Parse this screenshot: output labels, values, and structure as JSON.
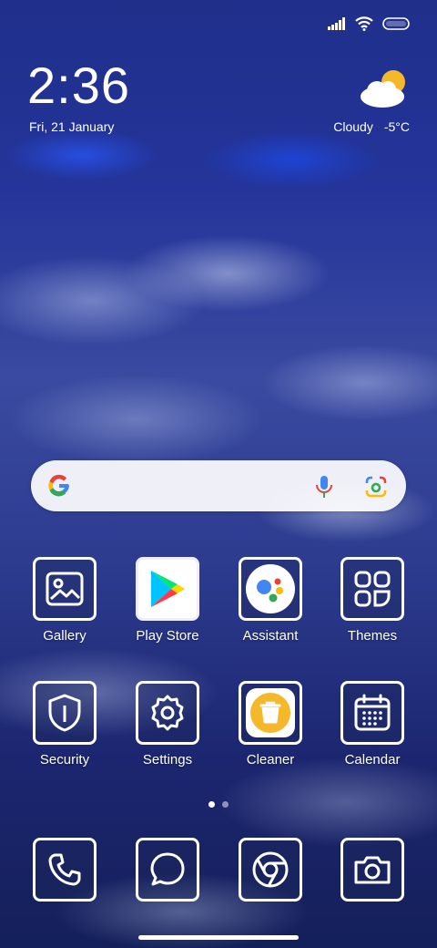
{
  "status_bar": {
    "icons": [
      "signal-icon",
      "wifi-icon",
      "battery-icon"
    ]
  },
  "clock": {
    "time": "2:36",
    "date": "Fri, 21 January"
  },
  "weather": {
    "condition": "Cloudy",
    "temperature": "-5°C",
    "icon": "cloudy-sun-icon"
  },
  "search_bar": {
    "icons": [
      "google-logo-icon",
      "mic-icon",
      "lens-icon"
    ]
  },
  "apps": [
    {
      "label": "Gallery",
      "icon": "gallery-icon"
    },
    {
      "label": "Play Store",
      "icon": "play-store-icon"
    },
    {
      "label": "Assistant",
      "icon": "assistant-icon"
    },
    {
      "label": "Themes",
      "icon": "themes-icon"
    },
    {
      "label": "Security",
      "icon": "shield-icon"
    },
    {
      "label": "Settings",
      "icon": "gear-icon"
    },
    {
      "label": "Cleaner",
      "icon": "trash-icon"
    },
    {
      "label": "Calendar",
      "icon": "calendar-icon"
    }
  ],
  "dock": [
    {
      "icon": "phone-icon"
    },
    {
      "icon": "messages-icon"
    },
    {
      "icon": "chrome-icon"
    },
    {
      "icon": "camera-icon"
    }
  ],
  "page_indicator": {
    "count": 2,
    "active": 1
  }
}
